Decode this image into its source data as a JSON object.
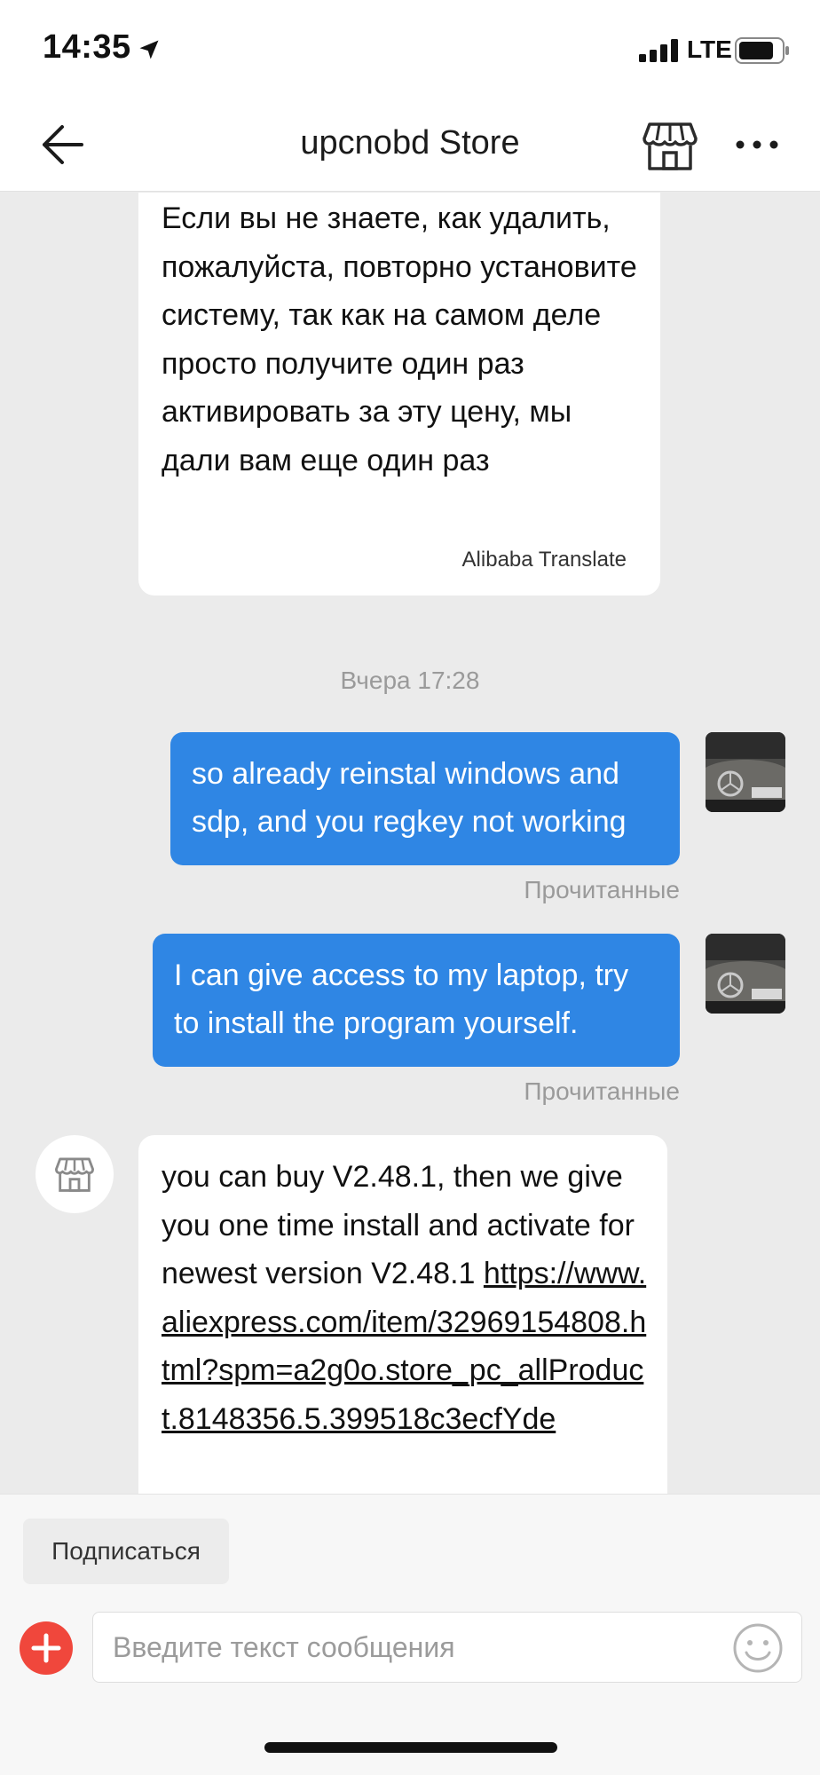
{
  "status_bar": {
    "time": "14:35",
    "network": "LTE",
    "icons": [
      "location-arrow-icon",
      "signal-icon",
      "battery-icon"
    ]
  },
  "header": {
    "title": "upcnobd Store",
    "icons": [
      "back-arrow-icon",
      "store-icon",
      "more-icon"
    ]
  },
  "messages": [
    {
      "direction": "incoming",
      "text": "Если вы не знаете, как удалить, пожалуйста, повторно установите систему, так как на самом деле просто получите один раз активировать за эту цену, мы дали вам еще один раз",
      "translation_credit": "Alibaba Translate"
    },
    {
      "direction": "outgoing",
      "text": "so already reinstal windows and sdp, and you regkey not working",
      "status": "Прочитанные"
    },
    {
      "direction": "outgoing",
      "text": "I can give access to my laptop, try to install the program yourself.",
      "status": "Прочитанные"
    },
    {
      "direction": "incoming",
      "text": "you can buy V2.48.1, then we give you one time install and activate for newest version V2.48.1",
      "link": "https://www.aliexpress.com/item/32969154808.html?spm=a2g0o.store_pc_allProduct.8148356.5.399518c3ecfYde"
    }
  ],
  "timestamp": "Вчера 17:28",
  "bottom": {
    "subscribe_label": "Подписаться",
    "input_placeholder": "Введите текст сообщения"
  },
  "colors": {
    "outgoing_bubble": "#2f86e4",
    "add_button": "#f0473c",
    "chat_background": "#ebebeb"
  }
}
